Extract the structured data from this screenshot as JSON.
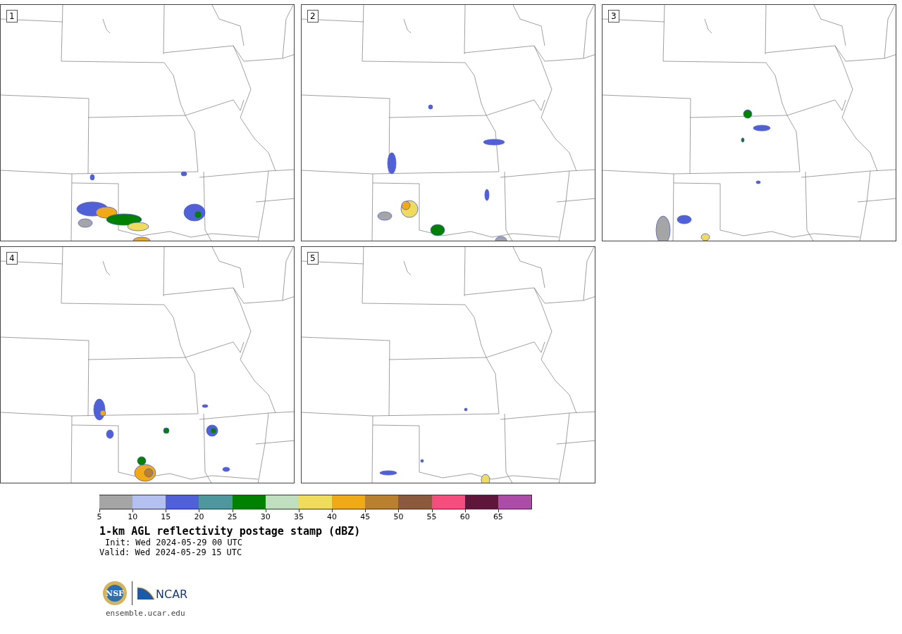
{
  "panels": [
    {
      "label": "1"
    },
    {
      "label": "2"
    },
    {
      "label": "3"
    },
    {
      "label": "4"
    },
    {
      "label": "5"
    }
  ],
  "colorbar": {
    "bins": [
      {
        "color": "#a5a5a5",
        "tick": "5"
      },
      {
        "color": "#b4c0ef",
        "tick": "10"
      },
      {
        "color": "#5060d6",
        "tick": "15"
      },
      {
        "color": "#4f979e",
        "tick": "20"
      },
      {
        "color": "#008200",
        "tick": "25"
      },
      {
        "color": "#bfdfbf",
        "tick": "30"
      },
      {
        "color": "#f0dc5c",
        "tick": "35"
      },
      {
        "color": "#f0aa18",
        "tick": "40"
      },
      {
        "color": "#b9802f",
        "tick": "45"
      },
      {
        "color": "#8b5a3e",
        "tick": "50"
      },
      {
        "color": "#f54e7e",
        "tick": "55"
      },
      {
        "color": "#60163a",
        "tick": "60"
      },
      {
        "color": "#ad4ca6",
        "tick": "65"
      }
    ]
  },
  "title": "1-km AGL reflectivity postage stamp (dBZ)",
  "init": "Init: Wed 2024-05-29 00 UTC",
  "valid": "Valid: Wed 2024-05-29 15 UTC",
  "logo": {
    "nsf": "NSF",
    "ncar": "NCAR"
  },
  "url": "ensemble.ucar.edu"
}
